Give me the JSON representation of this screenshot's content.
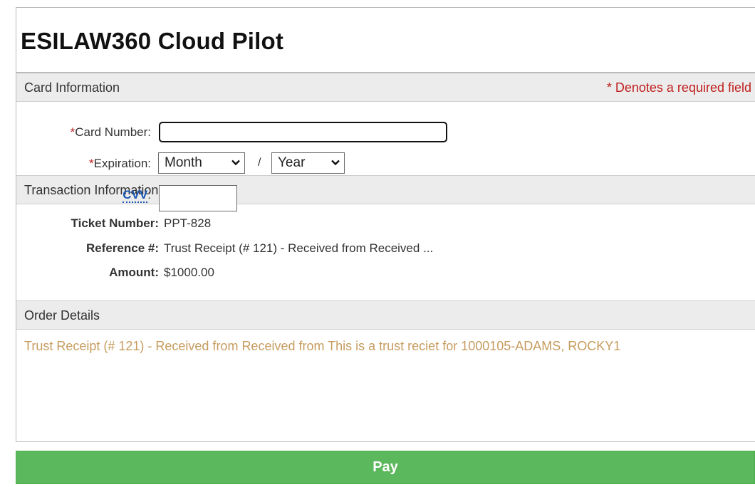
{
  "app": {
    "title": "ESILAW360 Cloud Pilot"
  },
  "card_section": {
    "heading": "Card Information",
    "required_note": "* Denotes a required field",
    "required_star": "*",
    "card_number_label": "Card Number:",
    "card_number_value": "",
    "expiration_label": "Expiration:",
    "month_value": "Month",
    "separator": "/",
    "year_value": "Year",
    "cvv_link": "CVV",
    "cvv_colon": ":",
    "cvv_value": ""
  },
  "transaction_section": {
    "heading": "Transaction Information",
    "rows": [
      {
        "label": "Ticket Number:",
        "value": "PPT-828"
      },
      {
        "label": "Reference #:",
        "value": "Trust Receipt (# 121) - Received from Received ..."
      },
      {
        "label": "Amount:",
        "value": "$1000.00"
      }
    ]
  },
  "order_section": {
    "heading": "Order Details",
    "details": "Trust Receipt (# 121) - Received from Received from This is a trust reciet for 1000105-ADAMS, ROCKY1"
  },
  "pay_button": {
    "label": "Pay"
  },
  "colors": {
    "required": "#c02020",
    "link": "#1a56b5",
    "order_text": "#c69c5e",
    "pay_button": "#5cb85c"
  },
  "icons": {
    "select_arrow": "chevron-down-icon"
  }
}
